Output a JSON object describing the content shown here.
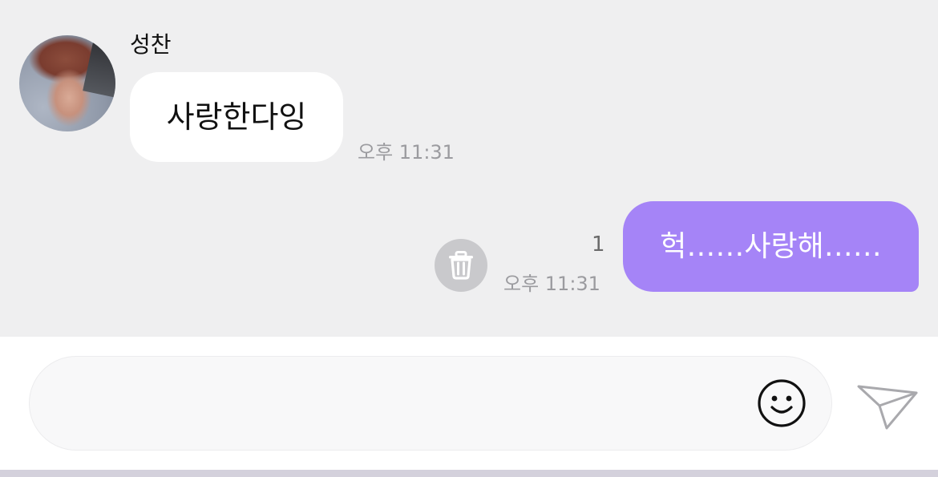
{
  "conversation": {
    "incoming": {
      "sender_name": "성찬",
      "text": "사랑한다잉",
      "time": "오후 11:31"
    },
    "outgoing": {
      "text": "헉……사랑해……",
      "time": "오후 11:31",
      "unread_count": "1"
    }
  },
  "composer": {
    "input_value": "",
    "placeholder": ""
  },
  "icons": {
    "avatar": "profile-photo",
    "delete": "trash-icon",
    "emoji": "smiley-icon",
    "send": "paper-plane-icon"
  },
  "colors": {
    "chat_background": "#efeff0",
    "outgoing_bubble": "#a584f7",
    "incoming_bubble": "#ffffff",
    "timestamp": "#9b9b9f"
  }
}
